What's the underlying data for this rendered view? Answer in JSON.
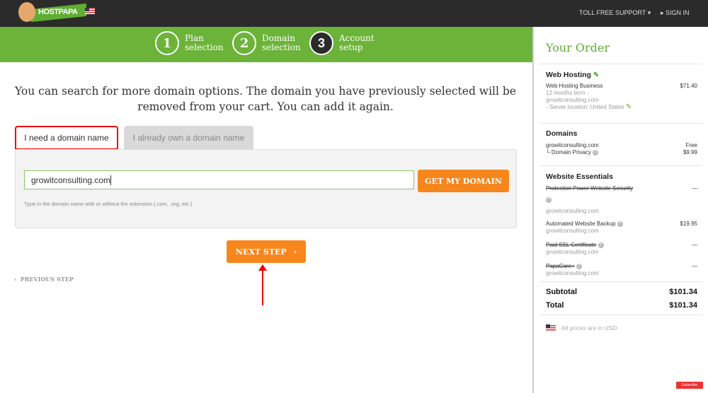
{
  "header": {
    "brand": "HOSTPAPA",
    "support_label": "TOLL FREE SUPPORT ▾",
    "signin_label": "SIGN IN"
  },
  "steps": [
    {
      "num": "1",
      "line1": "Plan",
      "line2": "selection",
      "done": true
    },
    {
      "num": "2",
      "line1": "Domain",
      "line2": "selection",
      "done": true
    },
    {
      "num": "3",
      "line1": "Account",
      "line2": "setup",
      "done": false
    }
  ],
  "main": {
    "intro": "You can search for more domain options. The domain you have previously selected will be removed from your cart. You can add it again.",
    "tabs": [
      {
        "label": "I need a domain name",
        "active": true
      },
      {
        "label": "I already own a domain name",
        "active": false
      }
    ],
    "domain_value": "growitconsulting.com",
    "get_domain_label": "GET MY DOMAIN",
    "hint": "Type in the domain name with or without the extension (.com, .org, etc.)",
    "next_label": "NEXT STEP",
    "prev_label": "PREVIOUS STEP"
  },
  "order": {
    "title": "Your Order",
    "web_hosting": {
      "title": "Web Hosting",
      "name": "Web Hosting Business",
      "price": "$71.40",
      "term": "12 months term -",
      "domain": "growitconsulting.com",
      "location": "- Server location: United States"
    },
    "domains": {
      "title": "Domains",
      "domain": "growitconsulting.com",
      "domain_price": "Free",
      "privacy": "└ Domain Privacy",
      "privacy_price": "$9.99"
    },
    "essentials": {
      "title": "Website Essentials",
      "items": [
        {
          "name": "Protection Power Website Security",
          "domain": "growitconsulting.com",
          "price": "—",
          "removed": true
        },
        {
          "name": "Automated Website Backup",
          "domain": "growitconsulting.com",
          "price": "$19.95",
          "removed": false
        },
        {
          "name": "Paid SSL Certificate",
          "domain": "growitconsulting.com",
          "price": "—",
          "removed": true
        },
        {
          "name": "PapaCare+",
          "domain": "growitconsulting.com",
          "price": "—",
          "removed": true
        }
      ]
    },
    "subtotal_label": "Subtotal",
    "subtotal": "$101.34",
    "total_label": "Total",
    "total": "$101.34",
    "currency_note": "All prices are in USD"
  },
  "overlay": {
    "subscribe": "Subscribe"
  },
  "colors": {
    "green": "#6cb33a",
    "orange": "#f7861c",
    "dark": "#2b2b2b",
    "highlight": "#e00000"
  }
}
